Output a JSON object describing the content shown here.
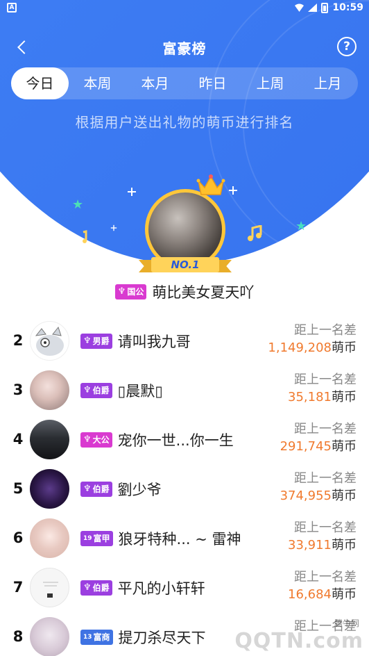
{
  "status_bar": {
    "time": "10:59",
    "left_icon": "A"
  },
  "nav": {
    "title": "富豪榜",
    "help_glyph": "?"
  },
  "tabs": [
    {
      "label": "今日",
      "active": true
    },
    {
      "label": "本周",
      "active": false
    },
    {
      "label": "本月",
      "active": false
    },
    {
      "label": "昨日",
      "active": false
    },
    {
      "label": "上周",
      "active": false
    },
    {
      "label": "上月",
      "active": false
    }
  ],
  "subtitle": "根据用户送出礼物的萌币进行排名",
  "champion": {
    "ribbon": "NO.1",
    "badge": "国公",
    "name": "萌比美女夏天吖"
  },
  "gap_label": "距上一名差",
  "currency": "萌币",
  "list": [
    {
      "rank": "2",
      "badge": "男爵",
      "name": "请叫我九哥",
      "gap": "1,149,208"
    },
    {
      "rank": "3",
      "badge": "伯爵",
      "name": "▯晨默▯",
      "gap": "35,181"
    },
    {
      "rank": "4",
      "badge": "大公",
      "name": "宠你一世...你一生",
      "gap": "291,745"
    },
    {
      "rank": "5",
      "badge": "伯爵",
      "name": "劉少爷",
      "gap": "374,955"
    },
    {
      "rank": "6",
      "badge": "富甲",
      "badge_level": "19",
      "name": "狼牙特种... ~ 雷神",
      "gap": "33,911"
    },
    {
      "rank": "7",
      "badge": "伯爵",
      "name": "平凡的小轩轩",
      "gap": "16,684"
    },
    {
      "rank": "8",
      "badge": "富商",
      "badge_level": "13",
      "name": "提刀杀尽天下",
      "gap": ""
    }
  ],
  "watermark": {
    "small": "腾牛网",
    "big": "QQTN.com"
  },
  "colors": {
    "primary_blue": "#3d7cf3",
    "gap_orange": "#f07a2e",
    "badge_pink": "#d93ad0",
    "badge_purple": "#9b3fe0",
    "badge_blue": "#3f73e3"
  },
  "icons": [
    "back-arrow-icon",
    "help-icon",
    "crown-icon",
    "star-icon",
    "music-note-icon",
    "sparkle-icon"
  ]
}
